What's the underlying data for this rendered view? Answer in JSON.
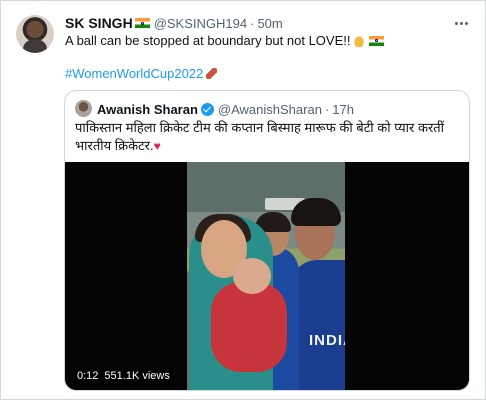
{
  "tweet": {
    "author_name": "SK SINGH",
    "author_handle": "@SKSINGH194",
    "separator": "·",
    "time": "50m",
    "text": "A ball can be stopped at boundary but not LOVE!!",
    "hashtag": "#WomenWorldCup2022"
  },
  "quoted": {
    "author_name": "Awanish Sharan",
    "author_handle": "@AwanishSharan",
    "separator": "·",
    "time": "17h",
    "text": "पाकिस्तान महिला क्रिकेट टीम की कप्तान बिस्माह मारूफ की बेटी को प्यार करतीं भारतीय क्रिकेटर.",
    "heart": "♥",
    "video": {
      "duration": "0:12",
      "views": "551.1K views",
      "jersey_text": "INDIA"
    }
  },
  "colors": {
    "link": "#1d9bf0",
    "muted": "#536471",
    "verified": "#1d9bf0",
    "heart": "#e0245e"
  }
}
